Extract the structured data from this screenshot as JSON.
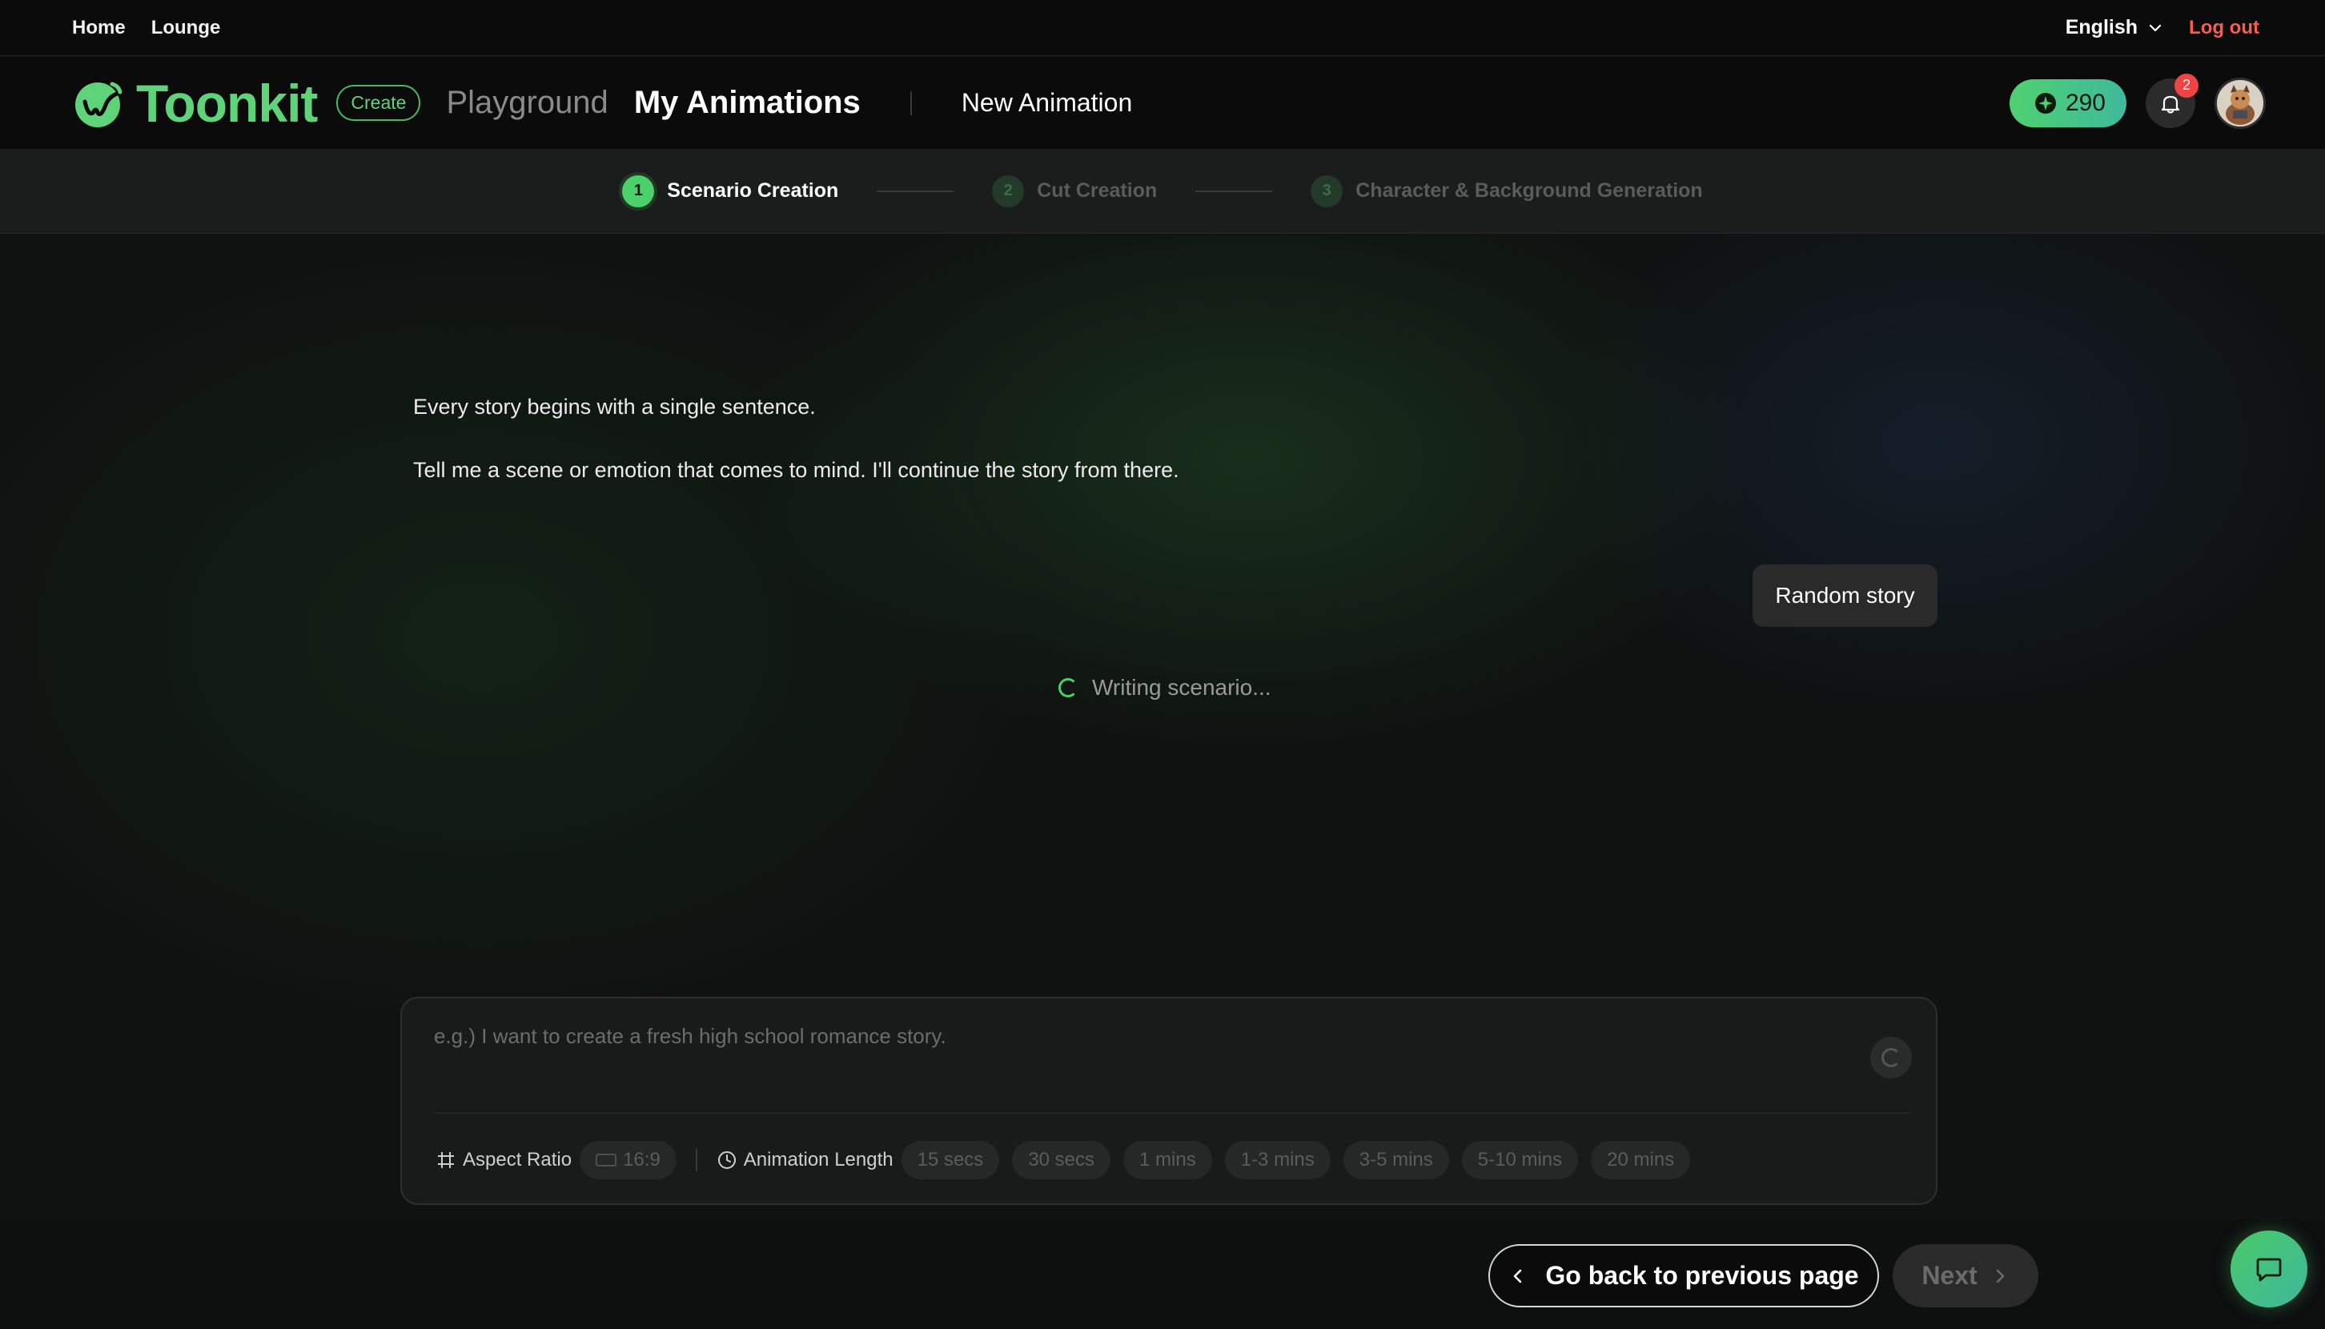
{
  "topbar": {
    "links": [
      {
        "label": "Home"
      },
      {
        "label": "Lounge"
      }
    ],
    "language": "English",
    "logout": "Log out"
  },
  "nav": {
    "brand": "Toonkit",
    "create_badge": "Create",
    "links": [
      {
        "label": "Playground",
        "active": false
      },
      {
        "label": "My Animations",
        "active": true
      }
    ],
    "new_animation": "New Animation",
    "credits": "290",
    "notifications": "2",
    "accent": "#4fd16f"
  },
  "stepper": {
    "steps": [
      {
        "num": "1",
        "label": "Scenario Creation",
        "active": true
      },
      {
        "num": "2",
        "label": "Cut Creation",
        "active": false
      },
      {
        "num": "3",
        "label": "Character & Background Generation",
        "active": false
      }
    ]
  },
  "conversation": {
    "line1": "Every story begins with a single sentence.",
    "line2": "Tell me a scene or emotion that comes to mind. I'll continue the story from there.",
    "user_chip": "Random story",
    "status": "Writing scenario..."
  },
  "composer": {
    "placeholder": "e.g.) I want to create a fresh high school romance story.",
    "aspect_ratio_label": "Aspect Ratio",
    "aspect_ratio_value": "16:9",
    "length_label": "Animation Length",
    "length_options": [
      "15 secs",
      "30 secs",
      "1 mins",
      "1-3 mins",
      "3-5 mins",
      "5-10 mins",
      "20 mins"
    ]
  },
  "footer": {
    "back": "Go back to previous page",
    "next": "Next"
  }
}
